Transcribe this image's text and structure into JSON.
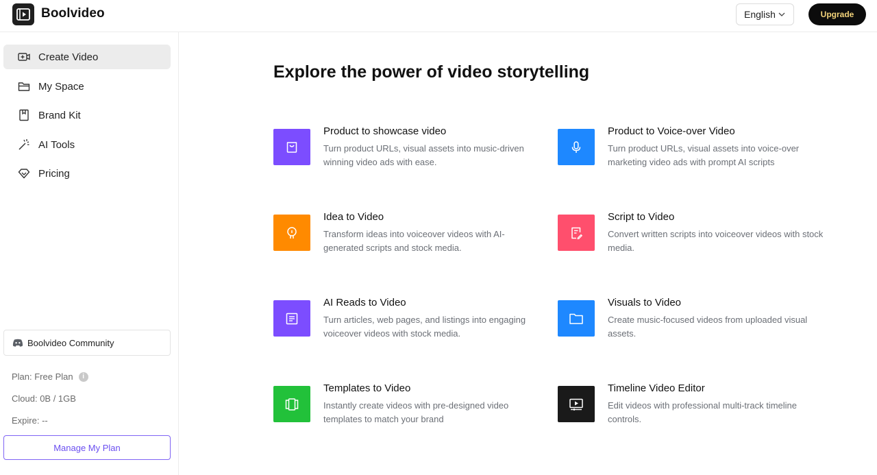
{
  "header": {
    "app_name": "Boolvideo",
    "language": "English",
    "upgrade_label": "Upgrade"
  },
  "sidebar": {
    "items": [
      {
        "label": "Create Video",
        "icon": "video-plus-icon",
        "active": true
      },
      {
        "label": "My Space",
        "icon": "folder-icon",
        "active": false
      },
      {
        "label": "Brand Kit",
        "icon": "bookmark-icon",
        "active": false
      },
      {
        "label": "AI Tools",
        "icon": "magic-wand-icon",
        "active": false
      },
      {
        "label": "Pricing",
        "icon": "diamond-icon",
        "active": false
      }
    ],
    "community_label": "Boolvideo Community",
    "plan": "Plan: Free Plan",
    "cloud": "Cloud: 0B / 1GB",
    "expire": "Expire: --",
    "manage_label": "Manage My Plan"
  },
  "main": {
    "title": "Explore the power of video storytelling",
    "cards": [
      {
        "title": "Product to showcase video",
        "desc": "Turn product URLs, visual assets into music-driven winning video ads with ease.",
        "icon": "shopping-bag-icon",
        "color": "#7c4dff"
      },
      {
        "title": "Product to Voice-over Video",
        "desc": "Turn product URLs, visual assets into voice-over marketing video ads with prompt AI scripts",
        "icon": "microphone-icon",
        "color": "#1e88ff"
      },
      {
        "title": "Idea to Video",
        "desc": "Transform ideas into voiceover videos with AI-generated scripts and stock media.",
        "icon": "lightbulb-icon",
        "color": "#ff8a00"
      },
      {
        "title": "Script to Video",
        "desc": "Convert written scripts into voiceover videos with stock media.",
        "icon": "document-edit-icon",
        "color": "#ff4f6d"
      },
      {
        "title": "AI Reads to Video",
        "desc": "Turn articles, web pages, and listings into engaging voiceover videos with stock media.",
        "icon": "article-icon",
        "color": "#7c4dff"
      },
      {
        "title": "Visuals to Video",
        "desc": "Create music-focused videos from uploaded visual assets.",
        "icon": "folder-icon",
        "color": "#1e88ff"
      },
      {
        "title": "Templates to Video",
        "desc": "Instantly create videos with pre-designed video templates to match your brand",
        "icon": "template-icon",
        "color": "#22c13a"
      },
      {
        "title": "Timeline Video Editor",
        "desc": "Edit videos with professional multi-track timeline controls.",
        "icon": "monitor-play-icon",
        "color": "#1a1a1a"
      }
    ]
  }
}
